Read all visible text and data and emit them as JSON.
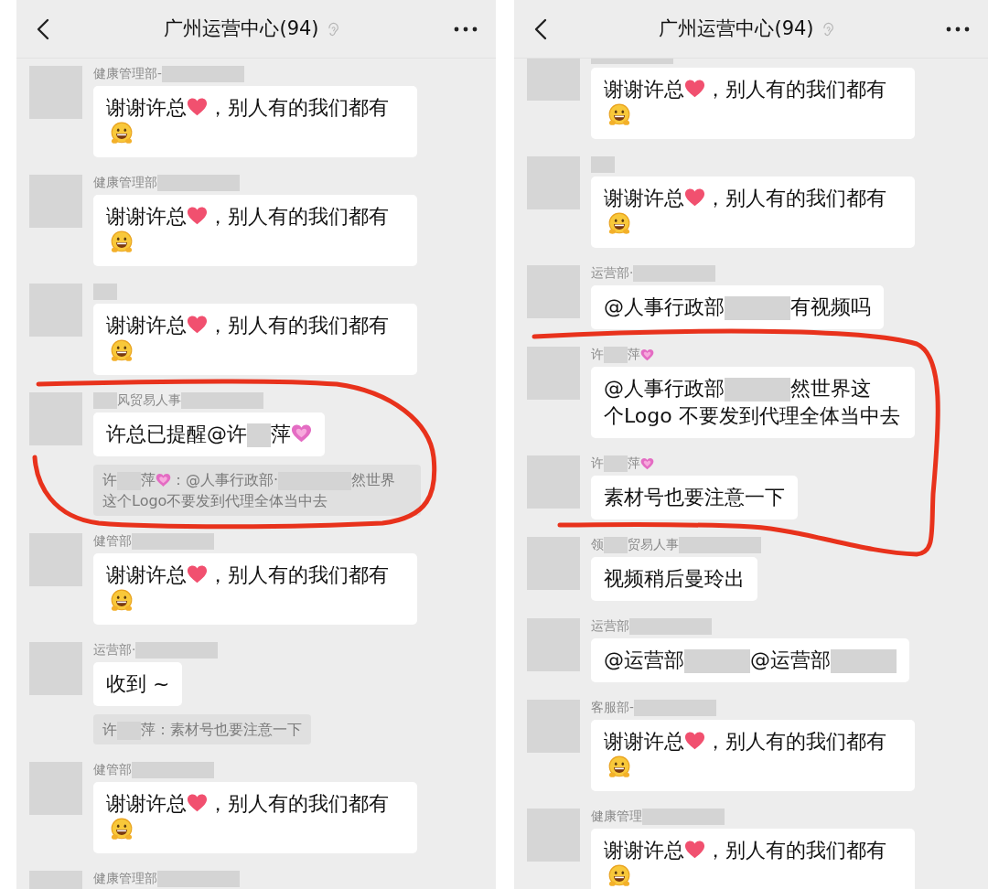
{
  "panels": [
    {
      "header": {
        "title": "广州运营中心(94)"
      },
      "messages": [
        {
          "sender": [
            {
              "kind": "text",
              "text": "健康管理部-"
            },
            {
              "kind": "redacted"
            }
          ],
          "parts": [
            {
              "kind": "text",
              "text": "谢谢许总"
            },
            {
              "kind": "heart"
            },
            {
              "kind": "text",
              "text": "，别人有的我们都有"
            },
            {
              "kind": "grin"
            }
          ]
        },
        {
          "sender": [
            {
              "kind": "text",
              "text": "健康管理部"
            },
            {
              "kind": "redacted"
            }
          ],
          "parts": [
            {
              "kind": "text",
              "text": "谢谢许总"
            },
            {
              "kind": "heart"
            },
            {
              "kind": "text",
              "text": "，别人有的我们都有"
            },
            {
              "kind": "grin"
            }
          ]
        },
        {
          "sender": [
            {
              "kind": "redacted_short"
            }
          ],
          "parts": [
            {
              "kind": "text",
              "text": "谢谢许总"
            },
            {
              "kind": "heart"
            },
            {
              "kind": "text",
              "text": "，别人有的我们都有"
            },
            {
              "kind": "grin"
            }
          ]
        },
        {
          "sender": [
            {
              "kind": "redacted_short"
            },
            {
              "kind": "text",
              "text": "风贸易人事"
            },
            {
              "kind": "redacted"
            }
          ],
          "parts": [
            {
              "kind": "text",
              "text": "许总已提醒@许"
            },
            {
              "kind": "redacted_short"
            },
            {
              "kind": "text",
              "text": "萍"
            },
            {
              "kind": "sparkle_heart"
            }
          ],
          "quote": [
            {
              "kind": "text",
              "text": "许"
            },
            {
              "kind": "redacted_short"
            },
            {
              "kind": "text",
              "text": "萍"
            },
            {
              "kind": "sparkle_heart"
            },
            {
              "kind": "text",
              "text": "：@人事行政部·"
            },
            {
              "kind": "redacted"
            },
            {
              "kind": "text",
              "text": "然世界"
            },
            {
              "kind": "text",
              "text": "这个Logo不要发到代理全体当中去"
            }
          ]
        },
        {
          "sender": [
            {
              "kind": "text",
              "text": "健管部"
            },
            {
              "kind": "redacted"
            }
          ],
          "parts": [
            {
              "kind": "text",
              "text": "谢谢许总"
            },
            {
              "kind": "heart"
            },
            {
              "kind": "text",
              "text": "，别人有的我们都有"
            },
            {
              "kind": "grin"
            }
          ]
        },
        {
          "sender": [
            {
              "kind": "text",
              "text": "运营部·"
            },
            {
              "kind": "redacted"
            }
          ],
          "parts": [
            {
              "kind": "text",
              "text": "收到 ~"
            }
          ],
          "quote": [
            {
              "kind": "text",
              "text": "许"
            },
            {
              "kind": "redacted_short"
            },
            {
              "kind": "text",
              "text": "萍：素材号也要注意一下"
            }
          ]
        },
        {
          "sender": [
            {
              "kind": "text",
              "text": "健管部"
            },
            {
              "kind": "redacted"
            }
          ],
          "parts": [
            {
              "kind": "text",
              "text": "谢谢许总"
            },
            {
              "kind": "heart"
            },
            {
              "kind": "text",
              "text": "，别人有的我们都有"
            },
            {
              "kind": "grin"
            }
          ]
        },
        {
          "sender": [
            {
              "kind": "text",
              "text": "健康管理部"
            },
            {
              "kind": "redacted"
            }
          ]
        }
      ]
    },
    {
      "header": {
        "title": "广州运营中心(94)"
      },
      "messages": [
        {
          "sender": [
            {
              "kind": "redacted"
            }
          ],
          "parts": [
            {
              "kind": "text",
              "text": "谢谢许总"
            },
            {
              "kind": "heart"
            },
            {
              "kind": "text",
              "text": "，别人有的我们都有"
            },
            {
              "kind": "grin"
            }
          ]
        },
        {
          "sender": [
            {
              "kind": "redacted_short"
            }
          ],
          "parts": [
            {
              "kind": "text",
              "text": "谢谢许总"
            },
            {
              "kind": "heart"
            },
            {
              "kind": "text",
              "text": "，别人有的我们都有"
            },
            {
              "kind": "grin"
            }
          ]
        },
        {
          "sender": [
            {
              "kind": "text",
              "text": "运营部·"
            },
            {
              "kind": "redacted"
            }
          ],
          "parts": [
            {
              "kind": "text",
              "text": "@人事行政部"
            },
            {
              "kind": "redacted"
            },
            {
              "kind": "text",
              "text": "有视频吗"
            }
          ]
        },
        {
          "sender": [
            {
              "kind": "text",
              "text": "许"
            },
            {
              "kind": "redacted_short"
            },
            {
              "kind": "text",
              "text": "萍"
            },
            {
              "kind": "sparkle_heart"
            }
          ],
          "parts": [
            {
              "kind": "text",
              "text": "@人事行政部"
            },
            {
              "kind": "redacted"
            },
            {
              "kind": "text",
              "text": "然世界这"
            },
            {
              "kind": "text",
              "text": "个Logo 不要发到代理全体当中去"
            }
          ]
        },
        {
          "sender": [
            {
              "kind": "text",
              "text": "许"
            },
            {
              "kind": "redacted_short"
            },
            {
              "kind": "text",
              "text": "萍"
            },
            {
              "kind": "sparkle_heart"
            }
          ],
          "parts": [
            {
              "kind": "text",
              "text": "素材号也要注意一下"
            }
          ]
        },
        {
          "sender": [
            {
              "kind": "text",
              "text": "领"
            },
            {
              "kind": "redacted_short"
            },
            {
              "kind": "text",
              "text": "贸易人事"
            },
            {
              "kind": "redacted"
            }
          ],
          "parts": [
            {
              "kind": "text",
              "text": "视频稍后曼玲出"
            }
          ]
        },
        {
          "sender": [
            {
              "kind": "text",
              "text": "运营部"
            },
            {
              "kind": "redacted"
            }
          ],
          "parts": [
            {
              "kind": "text",
              "text": "@运营部"
            },
            {
              "kind": "redacted"
            },
            {
              "kind": "text",
              "text": "@运营部"
            },
            {
              "kind": "redacted"
            }
          ]
        },
        {
          "sender": [
            {
              "kind": "text",
              "text": "客服部-"
            },
            {
              "kind": "redacted"
            }
          ],
          "parts": [
            {
              "kind": "text",
              "text": "谢谢许总"
            },
            {
              "kind": "heart"
            },
            {
              "kind": "text",
              "text": "，别人有的我们都有"
            },
            {
              "kind": "grin"
            }
          ]
        },
        {
          "sender": [
            {
              "kind": "text",
              "text": "健康管理"
            },
            {
              "kind": "redacted"
            }
          ],
          "parts": [
            {
              "kind": "text",
              "text": "谢谢许总"
            },
            {
              "kind": "heart"
            },
            {
              "kind": "text",
              "text": "，别人有的我们都有"
            },
            {
              "kind": "grin"
            }
          ]
        }
      ]
    }
  ]
}
